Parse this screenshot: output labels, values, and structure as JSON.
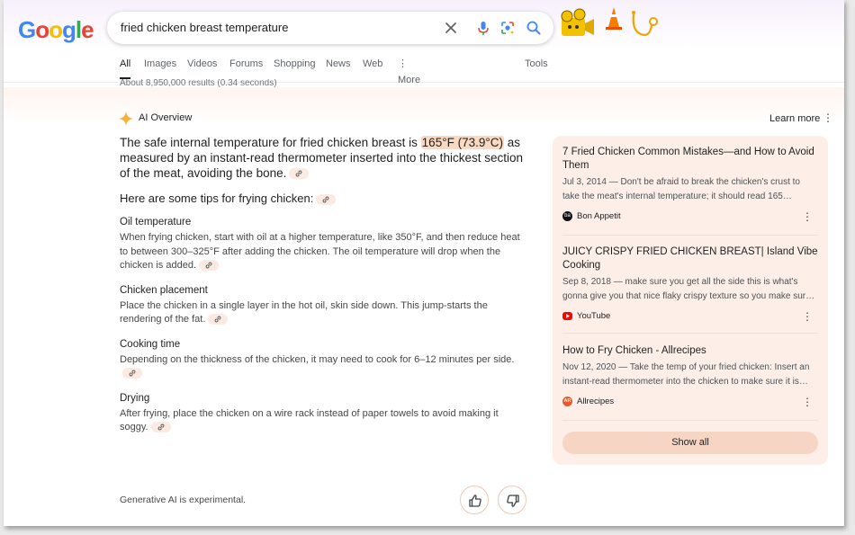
{
  "search": {
    "query": "fried chicken breast temperature",
    "logo": "Google"
  },
  "tabs": [
    {
      "label": "All",
      "active": true
    },
    {
      "label": "Images"
    },
    {
      "label": "Videos"
    },
    {
      "label": "Forums"
    },
    {
      "label": "Shopping"
    },
    {
      "label": "News"
    },
    {
      "label": "Web"
    },
    {
      "label": "More"
    },
    {
      "label": "Tools"
    }
  ],
  "results_stats": "About 8,950,000 results (0.34 seconds)",
  "ai_overview": {
    "label": "AI Overview",
    "learn_more": "Learn more",
    "answer_pre": "The safe internal temperature for fried chicken breast is ",
    "answer_highlight": "165°F (73.9°C)",
    "answer_post": " as measured by an instant-read thermometer inserted into the thickest section of the meat, avoiding the bone.",
    "tips_heading": "Here are some tips for frying chicken:",
    "sections": [
      {
        "heading": "Oil temperature",
        "text": "When frying chicken, start with oil at a higher temperature, like 350°F, and then reduce heat to between 300–325°F after adding the chicken. The oil temperature will drop when the chicken is added."
      },
      {
        "heading": "Chicken placement",
        "text": "Place the chicken in a single layer in the hot oil, skin side down. This jump-starts the rendering of the fat."
      },
      {
        "heading": "Cooking time",
        "text": "Depending on the thickness of the chicken, it may need to cook for 6–12 minutes per side."
      },
      {
        "heading": "Drying",
        "text": "After frying, place the chicken on a wire rack instead of paper towels to avoid making it soggy."
      }
    ],
    "footer": "Generative AI is experimental."
  },
  "sources": [
    {
      "title": "7 Fried Chicken Common Mistakes—and How to Avoid Them",
      "snippet": "Jul 3, 2014 — Don't be afraid to break the chicken's crust to take the meat's internal temperature; it should read 165…",
      "site": "Bon Appetit",
      "favicon_text": "ba",
      "favicon_color": "#111111"
    },
    {
      "title": "JUICY CRISPY FRIED CHICKEN BREAST| Island Vibe Cooking",
      "snippet": "Sep 8, 2018 — make sure you get all the side this is what's gonna give you that nice flaky crispy texture so you make sur…",
      "site": "YouTube",
      "favicon_text": "",
      "favicon_color": "#ff0000"
    },
    {
      "title": "How to Fry Chicken - Allrecipes",
      "snippet": "Nov 12, 2020 — Take the temp of your fried chicken: Insert an instant-read thermometer into the chicken to make sure it is…",
      "site": "Allrecipes",
      "favicon_text": "AR",
      "favicon_color": "#e8562a"
    }
  ],
  "show_all": "Show all",
  "colors": {
    "highlight": "#fbd8c0",
    "panel": "#fdefe8",
    "accent_blue": "#4285f4"
  },
  "icons": [
    "clear-icon",
    "mic-icon",
    "lens-icon",
    "search-icon",
    "sparkle-icon",
    "link-icon",
    "more-vert-icon",
    "thumbs-up-icon",
    "thumbs-down-icon"
  ]
}
